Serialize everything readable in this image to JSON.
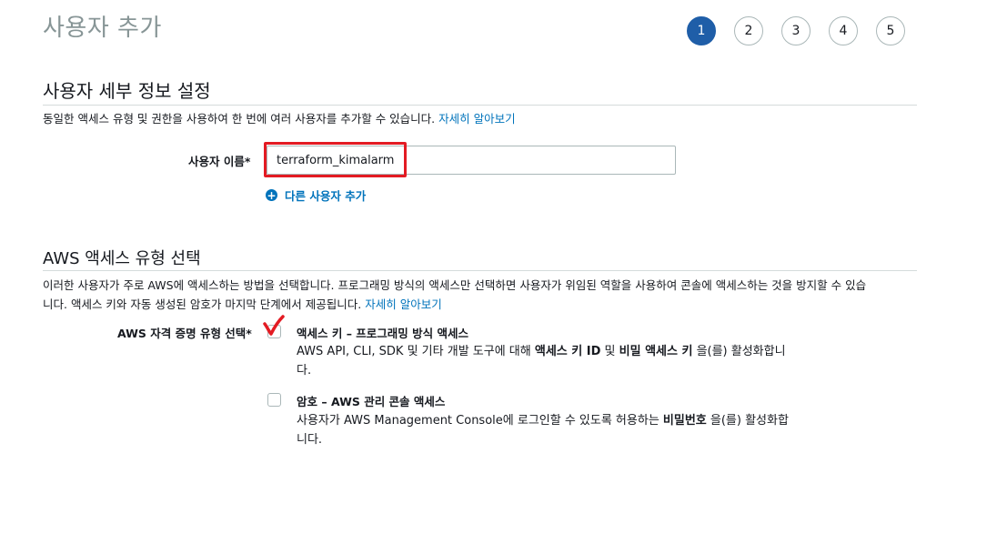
{
  "page_title": "사용자 추가",
  "steps": [
    "1",
    "2",
    "3",
    "4",
    "5"
  ],
  "active_step": "1",
  "user_details": {
    "section_title": "사용자 세부 정보 설정",
    "description": "동일한 액세스 유형 및 권한을 사용하여 한 번에 여러 사용자를 추가할 수 있습니다.",
    "learn_more": "자세히 알아보기",
    "username_label": "사용자 이름*",
    "username_value": "terraform_kimalarm",
    "add_user_label": "다른 사용자 추가"
  },
  "access_type": {
    "section_title": "AWS 액세스 유형 선택",
    "description_line1": "이러한 사용자가 주로 AWS에 액세스하는 방법을 선택합니다. 프로그래밍 방식의 액세스만 선택하면 사용자가 위임된 역할을 사용하여 콘솔에 액세스하는 것을 방지할 수 있습",
    "description_line2": "니다. 액세스 키와 자동 생성된 암호가 마지막 단계에서 제공됩니다.",
    "learn_more": "자세히 알아보기",
    "credential_label": "AWS 자격 증명 유형 선택*",
    "options": [
      {
        "title": "액세스 키 – 프로그래밍 방식 액세스",
        "desc_pre": "AWS API, CLI, SDK 및 기타 개발 도구에 대해 ",
        "desc_bold1": "액세스 키 ID",
        "desc_mid": " 및 ",
        "desc_bold2": "비밀 액세스 키",
        "desc_post": " 을(를) 활성화합니다."
      },
      {
        "title": "암호 – AWS 관리 콘솔 액세스",
        "desc_pre": "사용자가 AWS Management Console에 로그인할 수 있도록 허용하는 ",
        "desc_bold1": "비밀번호",
        "desc_post": " 을(를) 활성화합니다."
      }
    ]
  },
  "colors": {
    "accent": "#1f5ea8",
    "link": "#0073bb",
    "highlight": "#e31b23"
  }
}
